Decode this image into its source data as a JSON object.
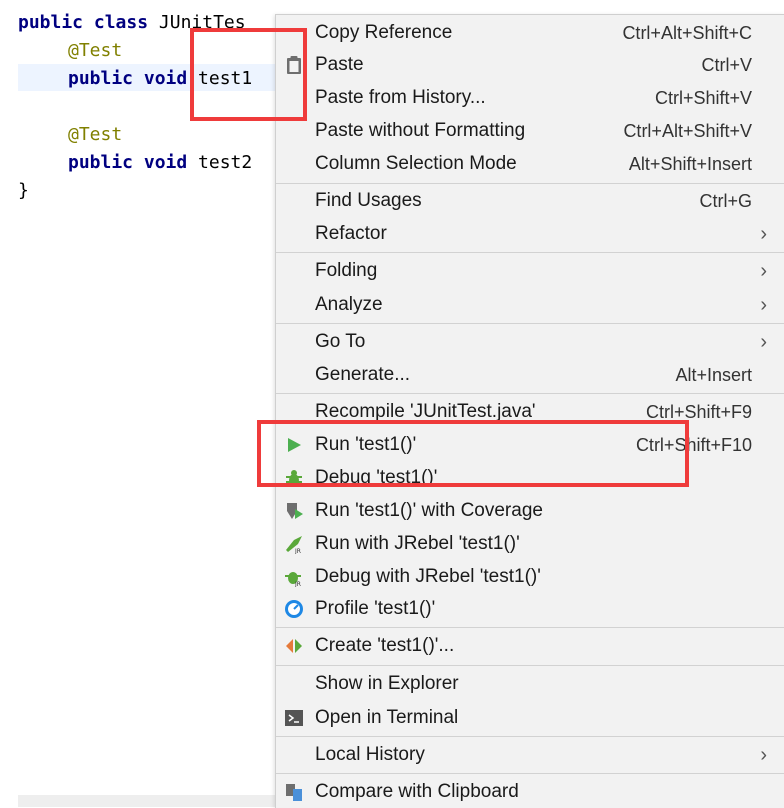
{
  "editor": {
    "line1": {
      "kw": "public class ",
      "text": "JUnitTes"
    },
    "line2": {
      "ann": "@Test"
    },
    "line3": {
      "kw": "public void ",
      "text": "test1"
    },
    "line5": {
      "ann": "@Test"
    },
    "line6": {
      "kw": "public void ",
      "text": "test2"
    },
    "line7": {
      "text": "}"
    }
  },
  "menu": {
    "items": [
      {
        "label": "Copy Reference",
        "shortcut": "Ctrl+Alt+Shift+C"
      },
      {
        "label": "Paste",
        "shortcut": "Ctrl+V",
        "icon": "clipboard-icon"
      },
      {
        "label": "Paste from History...",
        "shortcut": "Ctrl+Shift+V"
      },
      {
        "label": "Paste without Formatting",
        "shortcut": "Ctrl+Alt+Shift+V"
      },
      {
        "label": "Column Selection Mode",
        "shortcut": "Alt+Shift+Insert"
      },
      {
        "label": "Find Usages",
        "shortcut": "Ctrl+G"
      },
      {
        "label": "Refactor",
        "submenu": "›"
      },
      {
        "label": "Folding",
        "submenu": "›"
      },
      {
        "label": "Analyze",
        "submenu": "›"
      },
      {
        "label": "Go To",
        "submenu": "›"
      },
      {
        "label": "Generate...",
        "shortcut": "Alt+Insert"
      },
      {
        "label": "Recompile 'JUnitTest.java'",
        "shortcut": "Ctrl+Shift+F9"
      },
      {
        "label": "Run 'test1()'",
        "shortcut": "Ctrl+Shift+F10",
        "icon": "run-icon"
      },
      {
        "label": "Debug 'test1()'",
        "icon": "debug-icon"
      },
      {
        "label": "Run 'test1()' with Coverage",
        "icon": "coverage-icon"
      },
      {
        "label": "Run with JRebel 'test1()'",
        "icon": "jrebel-run-icon"
      },
      {
        "label": "Debug with JRebel 'test1()'",
        "icon": "jrebel-debug-icon"
      },
      {
        "label": "Profile 'test1()'",
        "icon": "profile-icon"
      },
      {
        "label": "Create 'test1()'...",
        "icon": "create-icon"
      },
      {
        "label": "Show in Explorer"
      },
      {
        "label": "Open in Terminal",
        "icon": "terminal-icon"
      },
      {
        "label": "Local History",
        "submenu": "›"
      },
      {
        "label": "Compare with Clipboard",
        "icon": "compare-icon"
      }
    ]
  },
  "colors": {
    "highlight": "#ef3b3b",
    "run": "#4caf50",
    "menu_bg": "#f2f2f2"
  }
}
